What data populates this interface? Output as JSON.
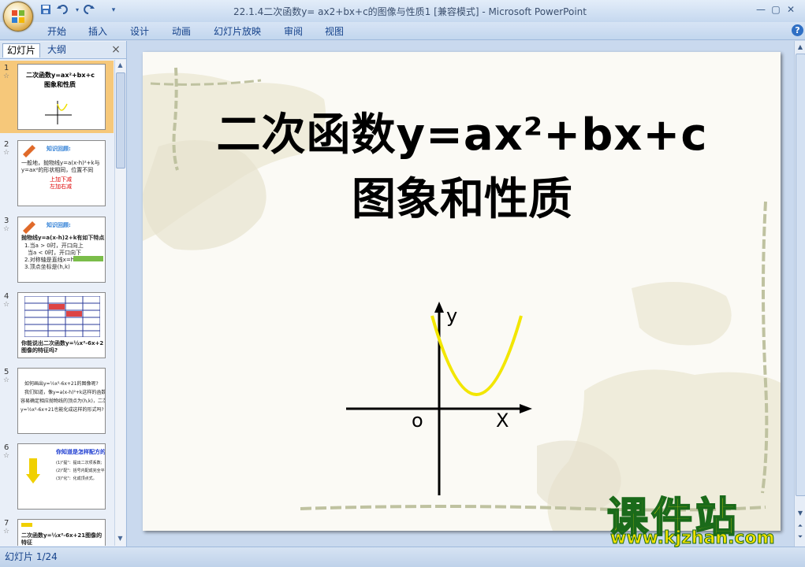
{
  "window": {
    "title": "22.1.4二次函数y= ax2+bx+c的图像与性质1 [兼容模式] - Microsoft PowerPoint",
    "controls": [
      "minimize",
      "maximize",
      "close"
    ]
  },
  "quick_access": [
    "save-icon",
    "undo-icon",
    "redo-icon",
    "customize-icon"
  ],
  "ribbon": {
    "tabs": [
      "开始",
      "插入",
      "设计",
      "动画",
      "幻灯片放映",
      "审阅",
      "视图"
    ],
    "help": "?"
  },
  "left_pane": {
    "tabs": [
      "幻灯片",
      "大纲"
    ],
    "close": "×",
    "slides": [
      {
        "num": "1",
        "title": "二次函数y=ax²+bx+c",
        "subtitle": "图象和性质",
        "selected": true
      },
      {
        "num": "2",
        "heading": "知识回顾:",
        "lines": [
          "一般地，抛物线y=a(x-h)²+k与",
          "y=ax²的形状相同，位置不同",
          "上加下减",
          "左加右减"
        ]
      },
      {
        "num": "3",
        "heading": "知识回顾:",
        "lines": [
          "抛物线y=a(x-h)2+k有如下特点",
          "1.当a > 0时，开口向上",
          "当a < 0时，开口向下",
          "2.对称轴是直线x=h",
          "3.顶点坐标是(h,k)"
        ]
      },
      {
        "num": "4",
        "lines": [
          "你能说出二次函数y=½x²-6x+2",
          "图像的特征吗?"
        ]
      },
      {
        "num": "5",
        "lines": [
          "如何画出y=½x²-6x+21的图像呢?",
          "我们知道，像y=a(x-h)²+k这样的函数，",
          "容易确定相应抛物线的顶点为(h,k)，二次函数",
          "y=½x²-6x+21也能化成这样的形式吗?"
        ]
      },
      {
        "num": "6",
        "lines": [
          "你知道是怎样配方的吗?",
          "(1)\"提\"：提出二次项系数;",
          "(2)\"配\"：括号内配成完全平方;",
          "(3)\"化\"：化成顶点式。"
        ]
      },
      {
        "num": "7",
        "lines": [
          "二次函数y=½x²-6x+21图像的",
          "特征"
        ]
      }
    ]
  },
  "slide": {
    "title_line1": "二次函数y=ax²+bx+c",
    "title_line2": "图象和性质",
    "graph": {
      "y_label": "y",
      "x_label": "X",
      "origin_label": "o"
    }
  },
  "watermark": {
    "text": "课件站",
    "url": "www.kjzhan.com"
  },
  "status": {
    "slide_indicator": "幻灯片 1/24"
  }
}
